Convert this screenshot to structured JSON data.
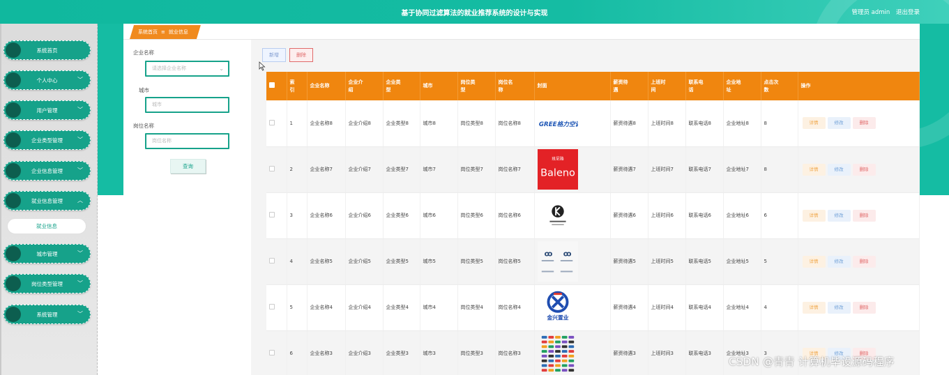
{
  "header": {
    "title": "基于协同过滤算法的就业推荐系统的设计与实现",
    "user_label": "管理员 admin",
    "logout_label": "退出登录"
  },
  "sidebar": {
    "items": [
      {
        "label": "系统首页",
        "has_chevron": false
      },
      {
        "label": "个人中心",
        "has_chevron": true,
        "chevron": "chevron-down-icon"
      },
      {
        "label": "用户管理",
        "has_chevron": true,
        "chevron": "chevron-down-icon"
      },
      {
        "label": "企业类型管理",
        "has_chevron": true,
        "chevron": "chevron-down-icon"
      },
      {
        "label": "企业信息管理",
        "has_chevron": true,
        "chevron": "chevron-down-icon"
      },
      {
        "label": "就业信息管理",
        "has_chevron": true,
        "chevron": "chevron-up-icon"
      },
      {
        "label": "城市管理",
        "has_chevron": true,
        "chevron": "chevron-down-icon"
      },
      {
        "label": "岗位类型管理",
        "has_chevron": true,
        "chevron": "chevron-down-icon"
      },
      {
        "label": "系统管理",
        "has_chevron": true,
        "chevron": "chevron-down-icon"
      }
    ],
    "active_submenu": "就业信息"
  },
  "breadcrumb": {
    "home": "系统首页",
    "separator": "≡",
    "current": "就业信息"
  },
  "filters": {
    "company_label": "企业名称",
    "company_placeholder": "请选择企业名称",
    "city_label": "城市",
    "city_placeholder": "城市",
    "position_label": "岗位名称",
    "position_placeholder": "岗位名称",
    "query_label": "查询"
  },
  "toolbar": {
    "add_label": "新增",
    "delete_label": "删除"
  },
  "table": {
    "headers": [
      "",
      "索引",
      "企业名称",
      "企业介绍",
      "企业类型",
      "城市",
      "岗位类型",
      "岗位名称",
      "封面",
      "薪资待遇",
      "上班时间",
      "联系电话",
      "企业地址",
      "点击次数",
      "操作"
    ],
    "header_display": [
      "",
      "索\n引",
      "企业名称",
      "企业介\n绍",
      "企业类\n型",
      "城市",
      "岗位类\n型",
      "岗位名\n称",
      "封面",
      "薪资待\n遇",
      "上班时\n间",
      "联系电\n话",
      "企业地\n址",
      "点击次\n数",
      "操作"
    ],
    "rows": [
      {
        "index": "1",
        "company": "企业名称8",
        "intro": "企业介绍8",
        "type": "企业类型8",
        "city": "城市8",
        "job_type": "岗位类型8",
        "job_name": "岗位名称8",
        "cover": "gree-logo",
        "salary": "薪资待遇8",
        "work_time": "上班时间8",
        "phone": "联系电话8",
        "address": "企业地址8",
        "clicks": "8"
      },
      {
        "index": "2",
        "company": "企业名称7",
        "intro": "企业介绍7",
        "type": "企业类型7",
        "city": "城市7",
        "job_type": "岗位类型7",
        "job_name": "岗位名称7",
        "cover": "baleno-logo",
        "salary": "薪资待遇7",
        "work_time": "上班时间7",
        "phone": "联系电话7",
        "address": "企业地址7",
        "clicks": "8"
      },
      {
        "index": "3",
        "company": "企业名称6",
        "intro": "企业介绍6",
        "type": "企业类型6",
        "city": "城市6",
        "job_type": "岗位类型6",
        "job_name": "岗位名称6",
        "cover": "k-logo",
        "salary": "薪资待遇6",
        "work_time": "上班时间6",
        "phone": "联系电话6",
        "address": "企业地址6",
        "clicks": "6"
      },
      {
        "index": "4",
        "company": "企业名称5",
        "intro": "企业介绍5",
        "type": "企业类型5",
        "city": "城市5",
        "job_type": "岗位类型5",
        "job_name": "岗位名称5",
        "cover": "brand-grid-logo",
        "salary": "薪资待遇5",
        "work_time": "上班时间5",
        "phone": "联系电话5",
        "address": "企业地址5",
        "clicks": "5"
      },
      {
        "index": "5",
        "company": "企业名称4",
        "intro": "企业介绍4",
        "type": "企业类型4",
        "city": "城市4",
        "job_type": "岗位类型4",
        "job_name": "岗位名称4",
        "cover": "jx-logo",
        "salary": "薪资待遇4",
        "work_time": "上班时间4",
        "phone": "联系电话4",
        "address": "企业地址4",
        "clicks": "4"
      },
      {
        "index": "6",
        "company": "企业名称3",
        "intro": "企业介绍3",
        "type": "企业类型3",
        "city": "城市3",
        "job_type": "岗位类型3",
        "job_name": "岗位名称3",
        "cover": "logo-collage",
        "salary": "薪资待遇3",
        "work_time": "上班时间3",
        "phone": "联系电话3",
        "address": "企业地址3",
        "clicks": "3"
      }
    ],
    "actions": {
      "detail": "详情",
      "edit": "修改",
      "delete": "删除"
    }
  },
  "cover_texts": {
    "gree": "GREE格力空调",
    "baleno": "Baleno",
    "baleno_small": "班尼路",
    "jx": "金兴置业"
  },
  "watermark": "CSDN @青青  计算机毕设源码程序",
  "colors": {
    "primary": "#16a28a",
    "header": "#15bca3",
    "accent": "#f0860f",
    "danger": "#e06a6a"
  }
}
